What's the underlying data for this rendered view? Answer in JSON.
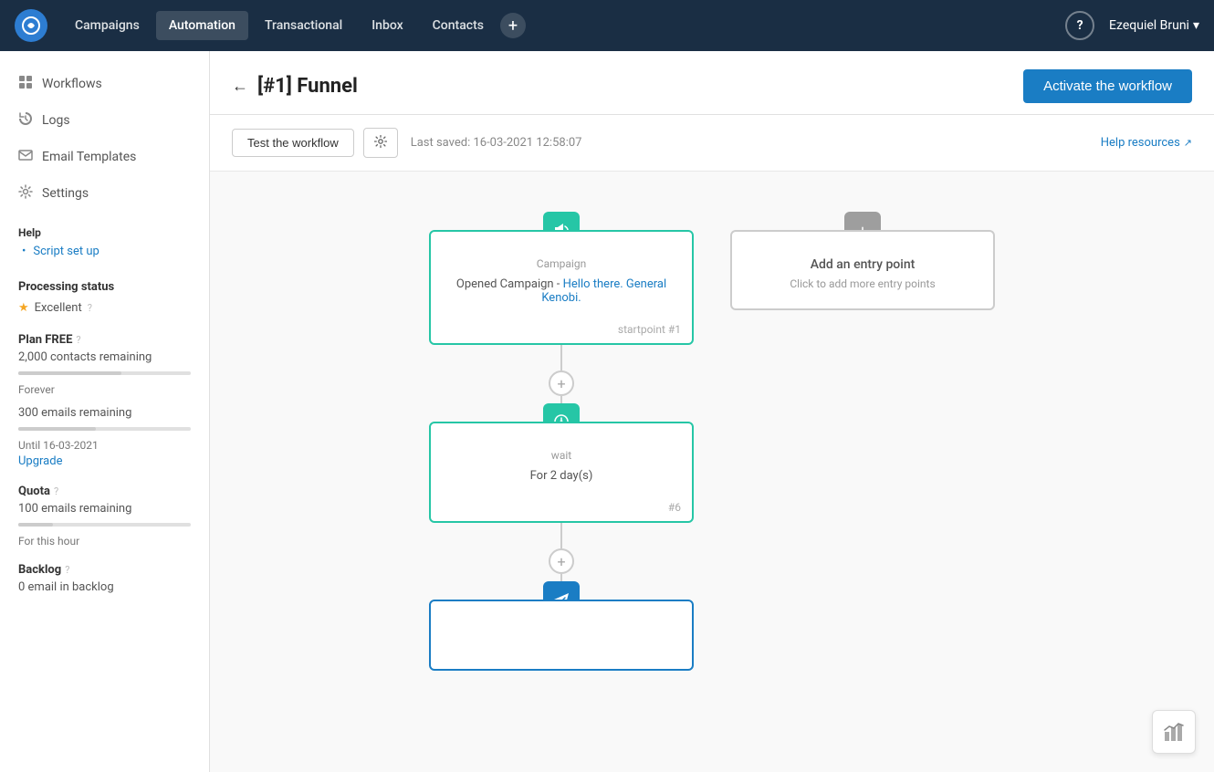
{
  "topnav": {
    "logo_icon": "◎",
    "items": [
      {
        "label": "Campaigns",
        "active": false
      },
      {
        "label": "Automation",
        "active": true
      },
      {
        "label": "Transactional",
        "active": false
      },
      {
        "label": "Inbox",
        "active": false
      },
      {
        "label": "Contacts",
        "active": false
      }
    ],
    "plus_icon": "+",
    "help_icon": "?",
    "user": "Ezequiel Bruni",
    "user_caret": "▾"
  },
  "sidebar": {
    "items": [
      {
        "label": "Workflows",
        "icon": "⊞"
      },
      {
        "label": "Logs",
        "icon": "⟳"
      },
      {
        "label": "Email Templates",
        "icon": "✉"
      },
      {
        "label": "Settings",
        "icon": "⚙"
      }
    ],
    "help_section": "Help",
    "script_setup": "Script set up",
    "processing_section": "Processing status",
    "processing_status": "Excellent",
    "plan_section": "Plan FREE",
    "contacts_remaining": "2,000 contacts remaining",
    "forever_label": "Forever",
    "emails_remaining": "300 emails remaining",
    "until_label": "Until 16-03-2021",
    "upgrade_label": "Upgrade",
    "quota_section": "Quota",
    "quota_emails": "100 emails remaining",
    "for_this_hour": "For this hour",
    "backlog_section": "Backlog",
    "backlog_value": "0 email in backlog"
  },
  "page": {
    "back_arrow": "←",
    "title": "[#1] Funnel",
    "activate_btn": "Activate the workflow",
    "test_btn": "Test the workflow",
    "gear_icon": "⚙",
    "last_saved": "Last saved: 16-03-2021 12:58:07",
    "help_resources": "Help resources",
    "external_link_icon": "↗"
  },
  "workflow": {
    "node1": {
      "type": "Campaign",
      "desc_prefix": "Opened Campaign - ",
      "desc_link": "Hello there. General Kenobi.",
      "footer": "startpoint #1",
      "icon": "📣"
    },
    "node2": {
      "type": "wait",
      "desc": "For 2 day(s)",
      "footer": "#6",
      "icon": "⚙"
    },
    "node3": {
      "icon": "✉"
    },
    "add_entry": {
      "title": "Add an entry point",
      "subtitle": "Click to add more entry points",
      "icon": "+"
    }
  },
  "colors": {
    "teal": "#26c6a6",
    "blue": "#1a7dc4",
    "nav_bg": "#1a2e44"
  }
}
